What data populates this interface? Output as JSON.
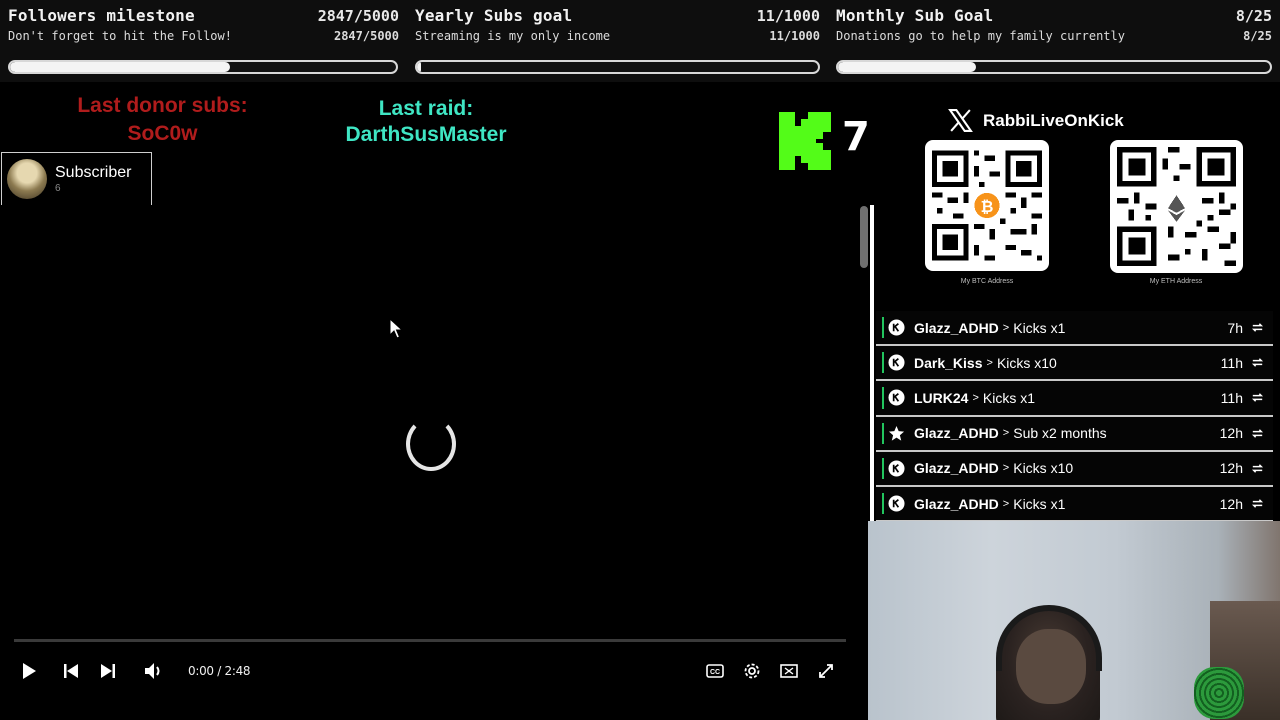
{
  "goals": [
    {
      "title": "Followers milestone",
      "count": "2847/5000",
      "subtitle": "Don't forget to hit the Follow!",
      "count_small": "2847/5000",
      "progress": 0.569
    },
    {
      "title": "Yearly Subs goal",
      "count": "11/1000",
      "subtitle": "Streaming is my only income",
      "count_small": "11/1000",
      "progress": 0.011
    },
    {
      "title": "Monthly Sub Goal",
      "count": "8/25",
      "subtitle": "Donations go to help my family currently",
      "count_small": "8/25",
      "progress": 0.32
    }
  ],
  "overlay": {
    "last_donor_label": "Last donor subs:",
    "last_donor_name": "SoC0w",
    "last_raid_label": "Last raid:",
    "last_raid_name": "DarthSusMaster",
    "kick_count": "7",
    "colors": {
      "donor": "#b01c1c",
      "raid": "#3fe6c4",
      "kick_green": "#53fc18",
      "feed_accent": "#22c55e"
    }
  },
  "subscriber_alert": {
    "label": "Subscriber",
    "count": "6"
  },
  "player": {
    "time": "0:00 / 2:48",
    "state": "loading",
    "icons": [
      "play-icon",
      "previous-icon",
      "next-icon",
      "volume-icon",
      "captions-icon",
      "settings-icon",
      "miniplayer-icon",
      "fullscreen-icon"
    ]
  },
  "right_panel": {
    "handle": "RabbiLiveOnKick",
    "btc_caption": "My BTC Address",
    "eth_caption": "My ETH Address"
  },
  "feed": [
    {
      "user": "Glazz_ADHD",
      "action": "Kicks x1",
      "ago": "7h",
      "icon": "kick-icon"
    },
    {
      "user": "Dark_Kiss",
      "action": "Kicks x10",
      "ago": "11h",
      "icon": "kick-icon"
    },
    {
      "user": "LURK24",
      "action": "Kicks x1",
      "ago": "11h",
      "icon": "kick-icon"
    },
    {
      "user": "Glazz_ADHD",
      "action": "Sub x2 months",
      "ago": "12h",
      "icon": "star-icon"
    },
    {
      "user": "Glazz_ADHD",
      "action": "Kicks x10",
      "ago": "12h",
      "icon": "kick-icon"
    },
    {
      "user": "Glazz_ADHD",
      "action": "Kicks x1",
      "ago": "12h",
      "icon": "kick-icon"
    }
  ]
}
